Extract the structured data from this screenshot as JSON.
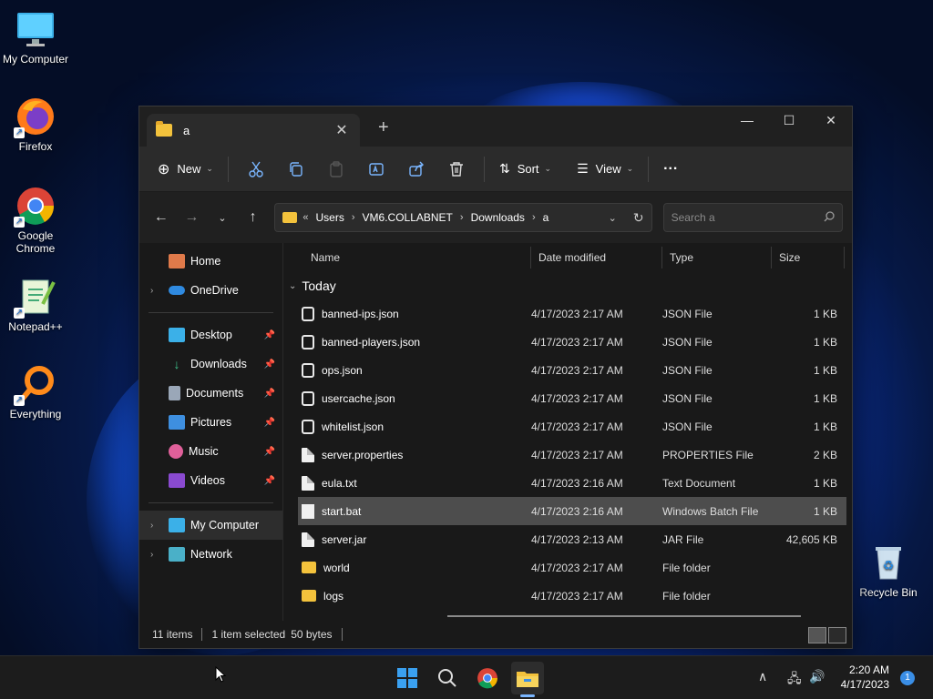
{
  "desktop": {
    "icons": [
      {
        "label": "My Computer"
      },
      {
        "label": "Firefox"
      },
      {
        "label": "Google Chrome"
      },
      {
        "label": "Notepad++"
      },
      {
        "label": "Everything"
      },
      {
        "label": "Recycle Bin"
      }
    ]
  },
  "window": {
    "tab_title": "a",
    "toolbar": {
      "new_label": "New",
      "sort_label": "Sort",
      "view_label": "View",
      "more_label": "···"
    },
    "address": {
      "overflow": "«",
      "crumbs": [
        "Users",
        "VM6.COLLABNET",
        "Downloads",
        "a"
      ]
    },
    "search": {
      "placeholder": "Search a"
    },
    "sidebar": {
      "items": [
        {
          "label": "Home"
        },
        {
          "label": "OneDrive"
        },
        {
          "label": "Desktop"
        },
        {
          "label": "Downloads"
        },
        {
          "label": "Documents"
        },
        {
          "label": "Pictures"
        },
        {
          "label": "Music"
        },
        {
          "label": "Videos"
        },
        {
          "label": "My Computer"
        },
        {
          "label": "Network"
        }
      ]
    },
    "columns": {
      "name": "Name",
      "date": "Date modified",
      "type": "Type",
      "size": "Size"
    },
    "group": "Today",
    "files": [
      {
        "name": "banned-ips.json",
        "date": "4/17/2023 2:17 AM",
        "type": "JSON File",
        "size": "1 KB",
        "icon": "json"
      },
      {
        "name": "banned-players.json",
        "date": "4/17/2023 2:17 AM",
        "type": "JSON File",
        "size": "1 KB",
        "icon": "json"
      },
      {
        "name": "ops.json",
        "date": "4/17/2023 2:17 AM",
        "type": "JSON File",
        "size": "1 KB",
        "icon": "json"
      },
      {
        "name": "usercache.json",
        "date": "4/17/2023 2:17 AM",
        "type": "JSON File",
        "size": "1 KB",
        "icon": "json"
      },
      {
        "name": "whitelist.json",
        "date": "4/17/2023 2:17 AM",
        "type": "JSON File",
        "size": "1 KB",
        "icon": "json"
      },
      {
        "name": "server.properties",
        "date": "4/17/2023 2:17 AM",
        "type": "PROPERTIES File",
        "size": "2 KB",
        "icon": "doc"
      },
      {
        "name": "eula.txt",
        "date": "4/17/2023 2:16 AM",
        "type": "Text Document",
        "size": "1 KB",
        "icon": "doc"
      },
      {
        "name": "start.bat",
        "date": "4/17/2023 2:16 AM",
        "type": "Windows Batch File",
        "size": "1 KB",
        "icon": "bat"
      },
      {
        "name": "server.jar",
        "date": "4/17/2023 2:13 AM",
        "type": "JAR File",
        "size": "42,605 KB",
        "icon": "doc"
      },
      {
        "name": "world",
        "date": "4/17/2023 2:17 AM",
        "type": "File folder",
        "size": "",
        "icon": "folder"
      },
      {
        "name": "logs",
        "date": "4/17/2023 2:17 AM",
        "type": "File folder",
        "size": "",
        "icon": "folder"
      }
    ],
    "status": {
      "count": "11 items",
      "selected": "1 item selected",
      "bytes": "50 bytes"
    }
  },
  "taskbar": {
    "time": "2:20 AM",
    "date": "4/17/2023",
    "notifications": "1"
  },
  "colors": {
    "accent": "#3a8ee6",
    "folder": "#f3c23c"
  }
}
